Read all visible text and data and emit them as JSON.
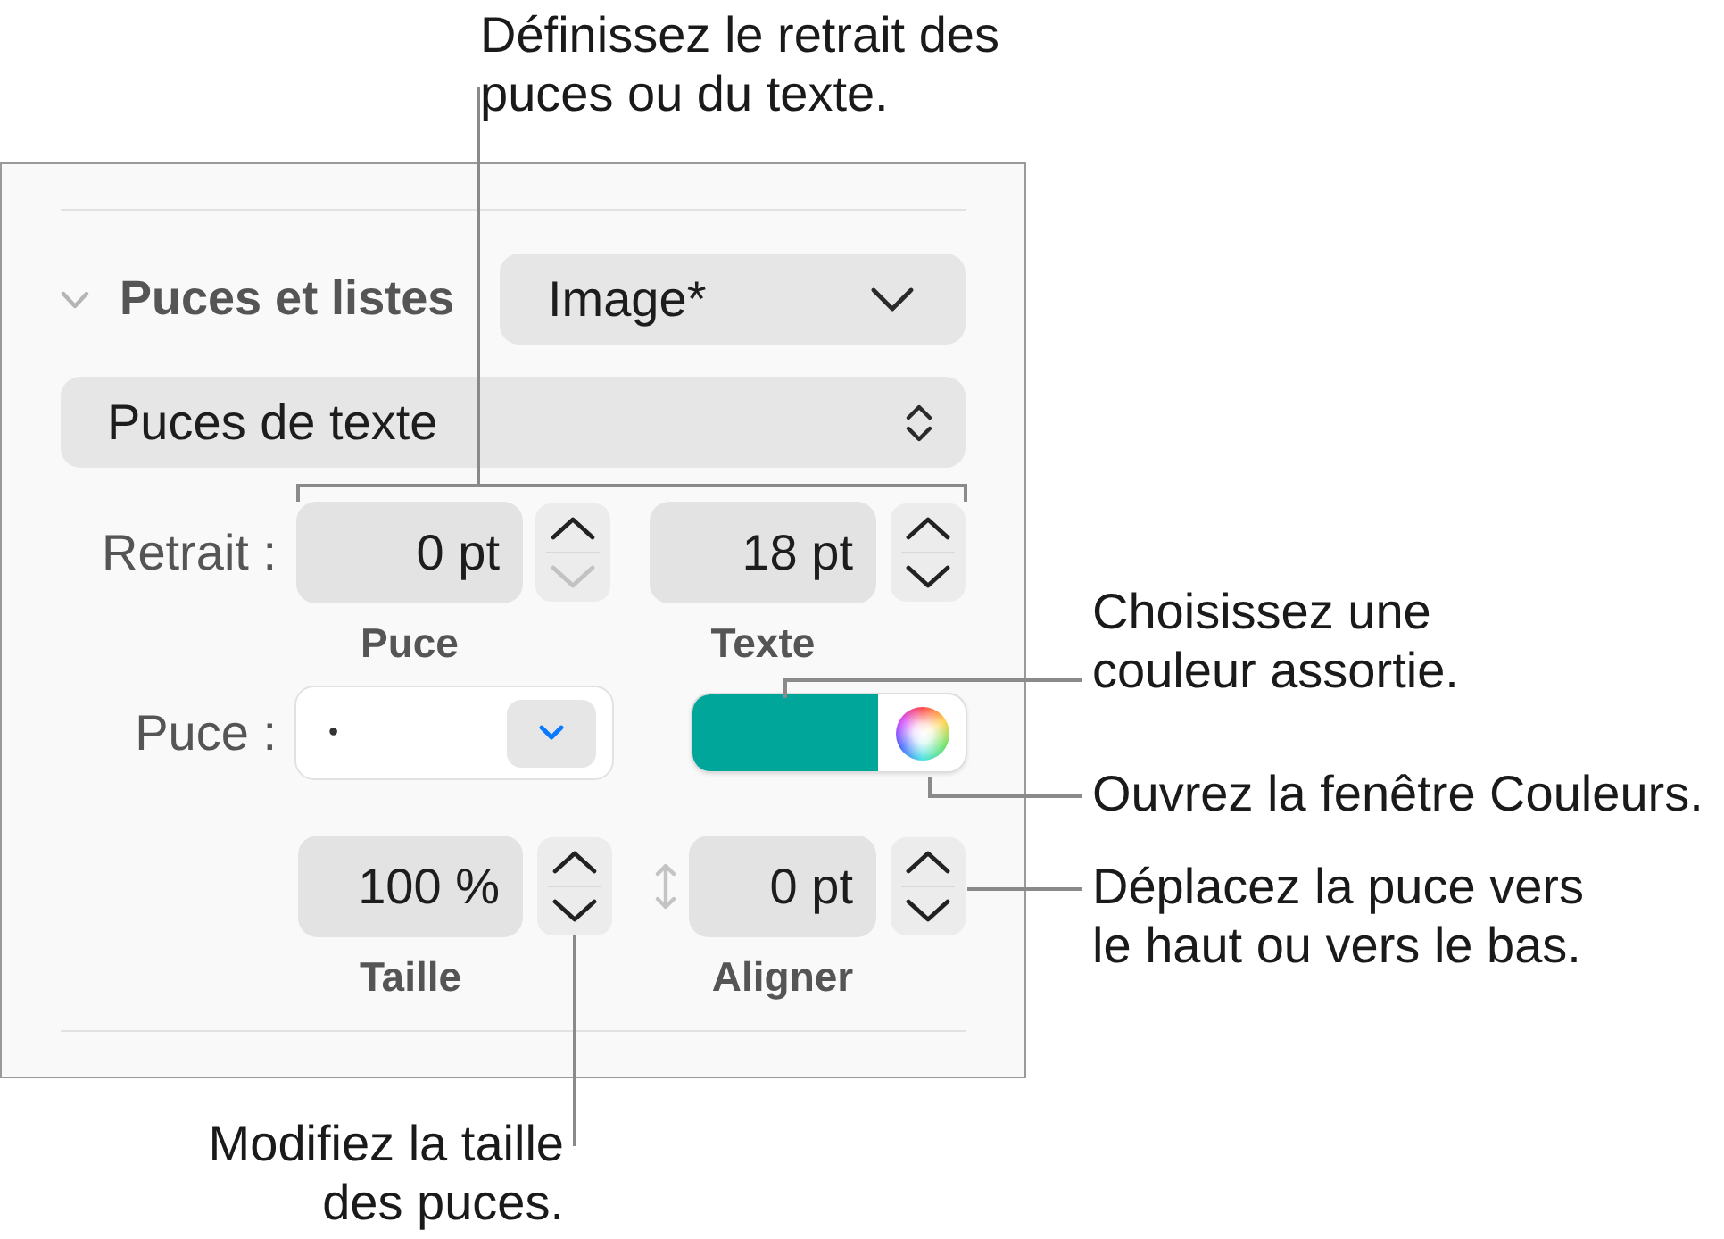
{
  "panel": {
    "section": {
      "title": "Puces et listes",
      "expanded": true,
      "style_popup": "Image*"
    },
    "list_type_popup": "Puces de texte",
    "indent": {
      "label": "Retrait :",
      "fields": [
        {
          "value": "0 pt",
          "caption": "Puce",
          "down_disabled": true
        },
        {
          "value": "18 pt",
          "caption": "Texte",
          "down_disabled": false
        }
      ]
    },
    "bullet": {
      "label": "Puce :",
      "value": "•",
      "color": "#00a69a"
    },
    "size": {
      "value": "100 %",
      "caption": "Taille",
      "down_disabled": false
    },
    "alignment": {
      "value": "0 pt",
      "caption": "Aligner",
      "down_disabled": false
    }
  },
  "callouts": {
    "indent": [
      "Définissez le retrait des",
      "puces ou du texte."
    ],
    "matching_color": [
      "Choisissez une",
      "couleur assortie."
    ],
    "colors_window": [
      "Ouvrez la fenêtre Couleurs."
    ],
    "bullet_alignment": [
      "Déplacez la puce vers",
      "le haut ou vers le bas."
    ],
    "bullet_size": [
      "Modifiez la taille",
      "des puces."
    ]
  }
}
